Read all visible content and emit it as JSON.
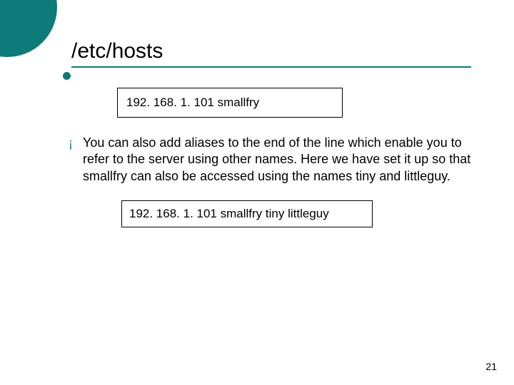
{
  "title": "/etc/hosts",
  "code_box_1": "192. 168. 1. 101  smallfry",
  "body_text": "You can also add aliases to the end of the line which enable you to refer to the server using other names. Here we have set it up so that smallfry can also be accessed using the names tiny and littleguy.",
  "code_box_2": "192. 168. 1. 101  smallfry  tiny  littleguy",
  "page_number": "21"
}
